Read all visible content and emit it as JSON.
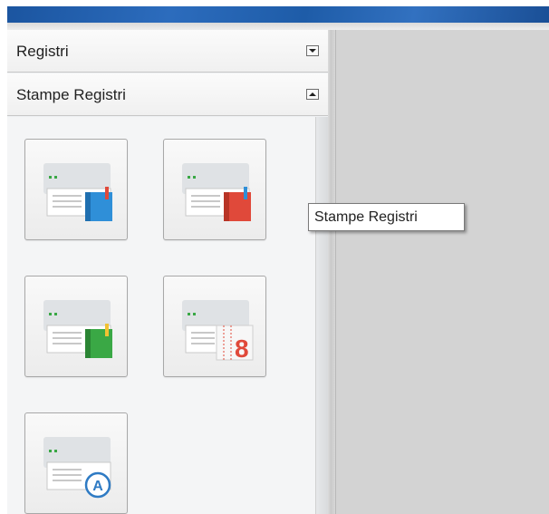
{
  "sidebar": {
    "sections": [
      {
        "label": "Registri",
        "state": "collapsed"
      },
      {
        "label": "Stampe Registri",
        "state": "expanded"
      }
    ],
    "buttons": [
      {
        "icon": "print-register-blue-icon",
        "accent": "#2f8fd8"
      },
      {
        "icon": "print-register-red-icon",
        "accent": "#e0493a"
      },
      {
        "icon": "print-register-green-icon",
        "accent": "#3aa845"
      },
      {
        "icon": "print-register-number-icon",
        "accent": "#e0493a",
        "glyph": "8"
      },
      {
        "icon": "print-register-a-icon",
        "accent": "#2f7bc4",
        "glyph": "A"
      }
    ]
  },
  "tooltip": {
    "text": "Stampe Registri"
  },
  "colors": {
    "titlebar": "#1e5ca8",
    "panel": "#eef0f2",
    "workspace": "#d3d3d3"
  }
}
